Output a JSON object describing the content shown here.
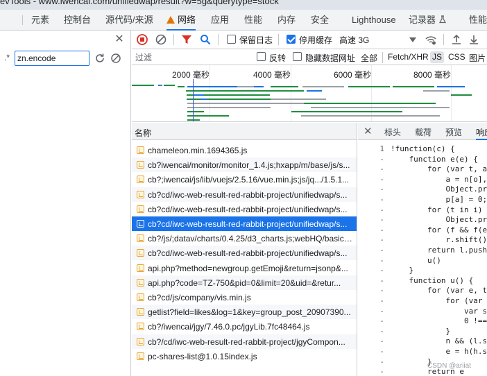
{
  "window": {
    "title": "evTools - www.iwencai.com/unifiedwap/result?w=5g&querytype=stock"
  },
  "tabs": [
    {
      "label": "元素"
    },
    {
      "label": "控制台"
    },
    {
      "label": "源代码/来源"
    },
    {
      "label": "网络"
    },
    {
      "label": "应用"
    },
    {
      "label": "性能"
    },
    {
      "label": "内存"
    },
    {
      "label": "安全"
    },
    {
      "label": "Lighthouse"
    },
    {
      "label": "记录器"
    },
    {
      "label": "性能"
    }
  ],
  "search": {
    "regex_label": ".*",
    "value": "zn.encode"
  },
  "toolbar": {
    "preserve_log_label": "保留日志",
    "preserve_log_checked": false,
    "disable_cache_label": "停用缓存",
    "disable_cache_checked": true,
    "throttle_label": "高速 3G"
  },
  "filter": {
    "placeholder": "过滤",
    "invert_label": "反转",
    "invert_checked": false,
    "hide_data_urls_label": "隐藏数据网址",
    "hide_data_urls_checked": false,
    "all_label": "全部",
    "types": [
      "Fetch/XHR",
      "JS",
      "CSS",
      "图片"
    ],
    "selected_type": "JS"
  },
  "timeline": {
    "ticks": [
      "2000 毫秒",
      "4000 毫秒",
      "6000 毫秒",
      "8000 毫秒"
    ]
  },
  "request_list": {
    "header": "名称",
    "rows": [
      {
        "name": "chameleon.min.1694365.js"
      },
      {
        "name": "cb?iwencai/monitor/monitor_1.4.js;hxapp/m/base/js/s..."
      },
      {
        "name": "cb?;iwencai/js/lib/vuejs/2.5.16/vue.min.js;js/jq.../1.5.1..."
      },
      {
        "name": "cb?cd/iwc-web-result-red-rabbit-project/unifiedwap/s..."
      },
      {
        "name": "cb?cd/iwc-web-result-red-rabbit-project/unifiedwap/s..."
      },
      {
        "name": "cb?cd/iwc-web-result-red-rabbit-project/unifiedwap/s..."
      },
      {
        "name": "cb?/js/;datav/charts/0.4.25/d3_charts.js;webHQ/basic/..."
      },
      {
        "name": "cb?cd/iwc-web-result-red-rabbit-project/unifiedwap/s..."
      },
      {
        "name": "api.php?method=newgroup.getEmoji&return=jsonp&..."
      },
      {
        "name": "api.php?code=TZ-750&pid=0&limit=20&uid=&retur..."
      },
      {
        "name": "cb?cd/js/company/vis.min.js"
      },
      {
        "name": "getlist?field=likes&log=1&key=group_post_20907390..."
      },
      {
        "name": "cb?/iwencai/jgy/7.46.0.pc/jgyLib.7fc48464.js"
      },
      {
        "name": "cb?/cd/iwc-web-result-red-rabbit-project/jgyCompon..."
      },
      {
        "name": "pc-shares-list@1.0.15index.js"
      }
    ],
    "selected_index": 5
  },
  "detail": {
    "tabs": [
      "标头",
      "载荷",
      "预览",
      "响应"
    ],
    "active_tab": "响应",
    "code_lines": [
      {
        "num": "1",
        "text": "!function(c) {"
      },
      {
        "num": "-",
        "text": "    function e(e) {"
      },
      {
        "num": "-",
        "text": "        for (var t, a"
      },
      {
        "num": "-",
        "text": "            a = n[o],"
      },
      {
        "num": "-",
        "text": "            Object.pro"
      },
      {
        "num": "-",
        "text": "            p[a] = 0;"
      },
      {
        "num": "-",
        "text": "        for (t in i)"
      },
      {
        "num": "-",
        "text": "            Object.pro"
      },
      {
        "num": "-",
        "text": "        for (f && f(e"
      },
      {
        "num": "-",
        "text": "            r.shift()"
      },
      {
        "num": "-",
        "text": "        return l.push"
      },
      {
        "num": "-",
        "text": "        u()"
      },
      {
        "num": "-",
        "text": "    }"
      },
      {
        "num": "-",
        "text": "    function u() {"
      },
      {
        "num": "-",
        "text": "        for (var e, t"
      },
      {
        "num": "-",
        "text": "            for (var a"
      },
      {
        "num": "-",
        "text": "                var s"
      },
      {
        "num": "-",
        "text": "                0 !=="
      },
      {
        "num": "-",
        "text": "            }"
      },
      {
        "num": "-",
        "text": "            n && (l.sp"
      },
      {
        "num": "-",
        "text": "            e = h(h.s"
      },
      {
        "num": "-",
        "text": "        }"
      },
      {
        "num": "-",
        "text": "        return e"
      }
    ]
  },
  "watermark": "CSDN @ariiat",
  "colors": {
    "accent": "#1a73e8",
    "record": "#d93025",
    "filter": "#d93025",
    "bar_green": "#1e8e3e",
    "bar_blue": "#1a73e8",
    "bar_gray": "#9aa0a6"
  }
}
